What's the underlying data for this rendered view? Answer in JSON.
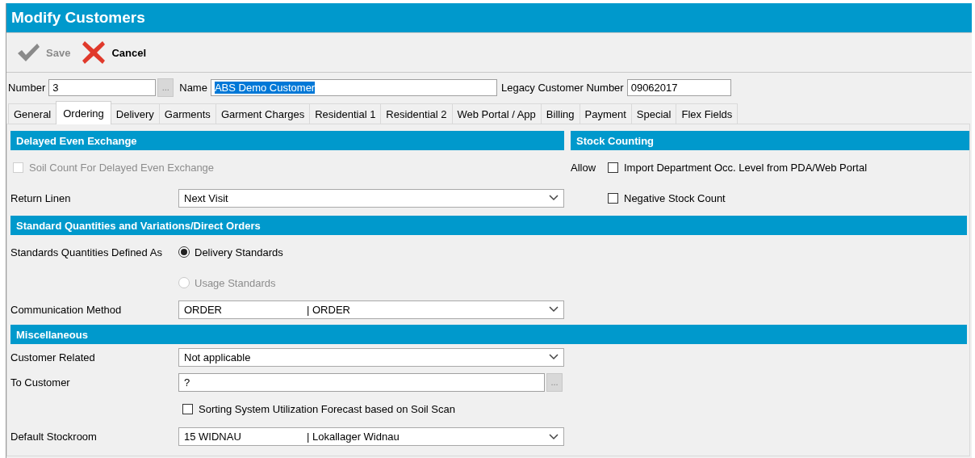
{
  "window": {
    "title": "Modify Customers"
  },
  "toolbar": [
    {
      "kind": "save",
      "label": "Save",
      "disabled": true
    },
    {
      "kind": "cancel",
      "label": "Cancel",
      "disabled": false
    }
  ],
  "header_fields": [
    {
      "label": "Number",
      "value": "3",
      "button": "...",
      "highlighted": false
    },
    {
      "label": "Name",
      "value": "ABS Demo Customer",
      "highlighted": true
    },
    {
      "label": "Legacy Customer Number",
      "value": "09062017",
      "highlighted": false
    }
  ],
  "tabs": [
    {
      "label": "General",
      "selected": false
    },
    {
      "label": "Ordering",
      "selected": true
    },
    {
      "label": "Delivery",
      "selected": false
    },
    {
      "label": "Garments",
      "selected": false
    },
    {
      "label": "Garment Charges",
      "selected": false
    },
    {
      "label": "Residential 1",
      "selected": false
    },
    {
      "label": "Residential 2",
      "selected": false
    },
    {
      "label": "Web Portal / App",
      "selected": false
    },
    {
      "label": "Billing",
      "selected": false
    },
    {
      "label": "Payment",
      "selected": false
    },
    {
      "label": "Special",
      "selected": false
    },
    {
      "label": "Flex Fields",
      "selected": false
    }
  ],
  "delayed_even_exchange": {
    "title": "Delayed Even Exchange",
    "soil_count": {
      "label": "Soil Count For Delayed Even Exchange",
      "checked": false,
      "disabled": true
    },
    "return_linen": {
      "label": "Return Linen",
      "value": "Next Visit"
    }
  },
  "stock_counting": {
    "title": "Stock Counting",
    "allow_label": "Allow",
    "options": [
      {
        "label": "Import Department Occ. Level from PDA/Web Portal",
        "checked": false
      },
      {
        "label": "Negative Stock Count",
        "checked": false
      }
    ]
  },
  "standard_quantities": {
    "title": "Standard Quantities and Variations/Direct Orders",
    "defined_as_label": "Standards Quantities Defined As",
    "options": [
      {
        "label": "Delivery Standards",
        "selected": true,
        "disabled": false
      },
      {
        "label": "Usage Standards",
        "selected": false,
        "disabled": true
      }
    ],
    "communication_method": {
      "label": "Communication Method",
      "value": "ORDER",
      "value_2": "| ORDER"
    }
  },
  "miscellaneous": {
    "title": "Miscellaneous",
    "customer_related": {
      "label": "Customer Related",
      "value": "Not applicable"
    },
    "to_customer": {
      "label": "To Customer",
      "value": "?",
      "button": "..."
    },
    "sorting_forecast": {
      "label": "Sorting System Utilization Forecast based on Soil Scan",
      "checked": false
    },
    "default_stockroom": {
      "label": "Default Stockroom",
      "value": "15 WIDNAU",
      "value_2": "| Lokallager Widnau"
    }
  }
}
